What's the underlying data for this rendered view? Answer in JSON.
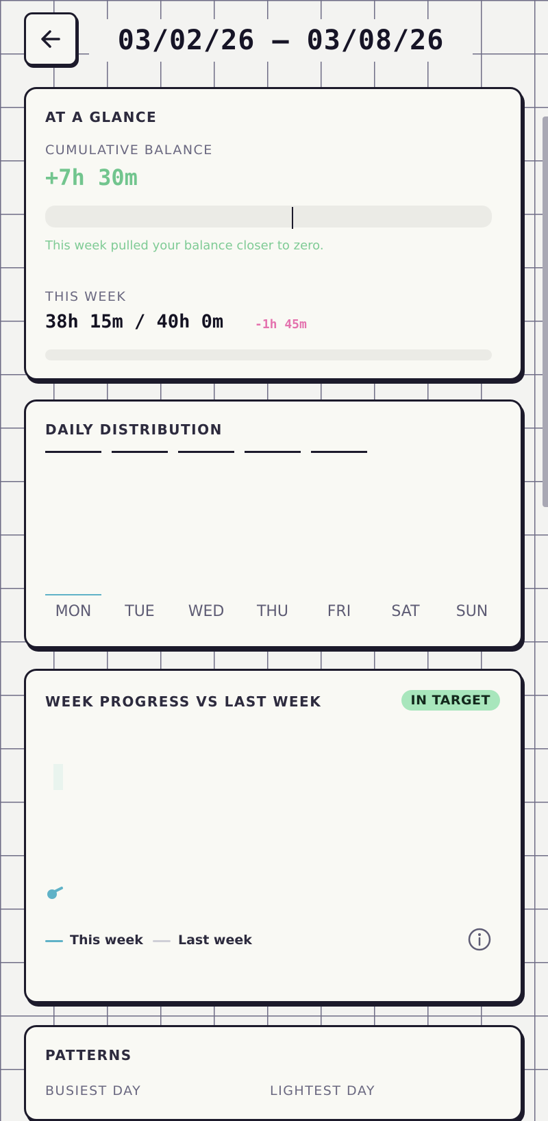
{
  "header": {
    "date_range": "03/02/26 – 03/08/26"
  },
  "at_a_glance": {
    "title": "AT A GLANCE",
    "balance_label": "CUMULATIVE BALANCE",
    "balance_value": "+7h 30m",
    "balance_note": "This week pulled your balance closer to zero.",
    "this_week_label": "THIS WEEK",
    "this_week_total": "38h 15m / 40h 0m",
    "this_week_delta": "-1h 45m"
  },
  "daily_distribution": {
    "title": "DAILY DISTRIBUTION",
    "days": [
      "MON",
      "TUE",
      "WED",
      "THU",
      "FRI",
      "SAT",
      "SUN"
    ]
  },
  "week_progress": {
    "title": "WEEK PROGRESS VS LAST WEEK",
    "badge": "IN TARGET",
    "legend_this_week": "This week",
    "legend_last_week": "Last week"
  },
  "patterns": {
    "title": "PATTERNS",
    "busiest_label": "BUSIEST DAY",
    "lightest_label": "LIGHTEST DAY"
  },
  "colors": {
    "accent_green": "#72c58e",
    "delta_pink": "#e472ae",
    "series_this_week": "#5fb2c7",
    "series_last_week": "#cfcfd6",
    "badge_bg": "#a8e6bc"
  }
}
